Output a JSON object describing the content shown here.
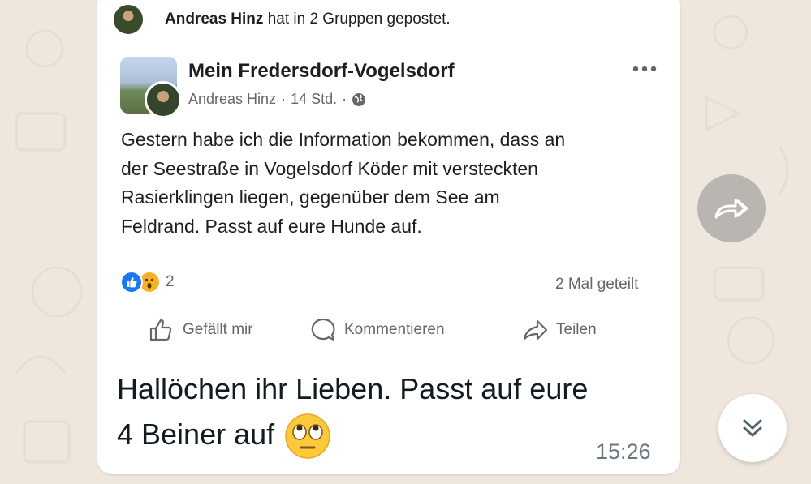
{
  "share_header": {
    "author": "Andreas Hinz",
    "action_text": "hat in 2 Gruppen gepostet."
  },
  "post": {
    "group_name": "Mein Fredersdorf-Vogelsdorf",
    "author": "Andreas Hinz",
    "time": "14 Std.",
    "privacy_icon": "globe-icon",
    "more_icon": "more-horizontal-icon",
    "body_lines": [
      "Gestern habe ich die Information bekommen, dass an",
      "der Seestraße in Vogelsdorf Köder mit versteckten",
      "Rasierklingen liegen, gegenüber dem See am",
      "Feldrand. Passt auf eure Hunde auf."
    ],
    "reaction_count": "2",
    "shares_text": "2 Mal geteilt",
    "actions": {
      "like": "Gefällt mir",
      "comment": "Kommentieren",
      "share": "Teilen"
    }
  },
  "message": {
    "lines": [
      "Hallöchen ihr Lieben. Passt auf eure",
      "4 Beiner auf"
    ],
    "emoji": "face-with-rolling-eyes",
    "time": "15:26"
  },
  "colors": {
    "accent_blue": "#1877f2",
    "wow_yellow": "#f7b125",
    "chat_background": "#efe7de"
  }
}
